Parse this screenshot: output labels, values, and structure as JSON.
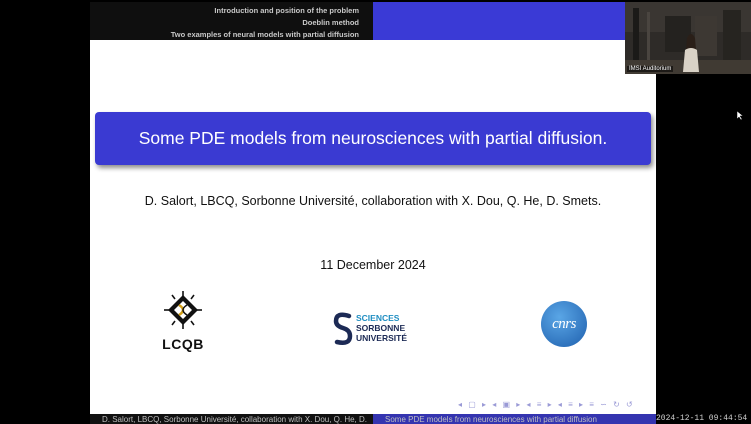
{
  "header": {
    "sections": [
      "Introduction and position of the problem",
      "Doeblin method",
      "Two examples of neural models with partial diffusion"
    ]
  },
  "slide": {
    "title": "Some PDE models from neurosciences with partial diffusion.",
    "authors": "D. Salort, LBCQ, Sorbonne Université, collaboration with X. Dou, Q. He, D. Smets.",
    "date": "11 December 2024",
    "logos": {
      "lcqb": "LCQB",
      "sorbonne": [
        "SCIENCES",
        "SORBONNE",
        "UNIVERSITÉ"
      ],
      "cnrs": "cnrs"
    },
    "nav_icons": "◂ ▢ ▸ ◂ ▣ ▸ ◂ ≡ ▸ ◂ ≡ ▸ ≡ ∽ ↻ ↺"
  },
  "footer": {
    "left": "D. Salort, LBCQ, Sorbonne Université, collaboration with X. Dou, Q. He, D.",
    "right": "Some PDE models from neurosciences with partial diffusion",
    "timestamp": "2024-12-11 09:44:54"
  },
  "video": {
    "label": "IMSI Auditorium"
  },
  "colors": {
    "accent": "#3a3ad2",
    "footer_right": "#3434b0"
  }
}
